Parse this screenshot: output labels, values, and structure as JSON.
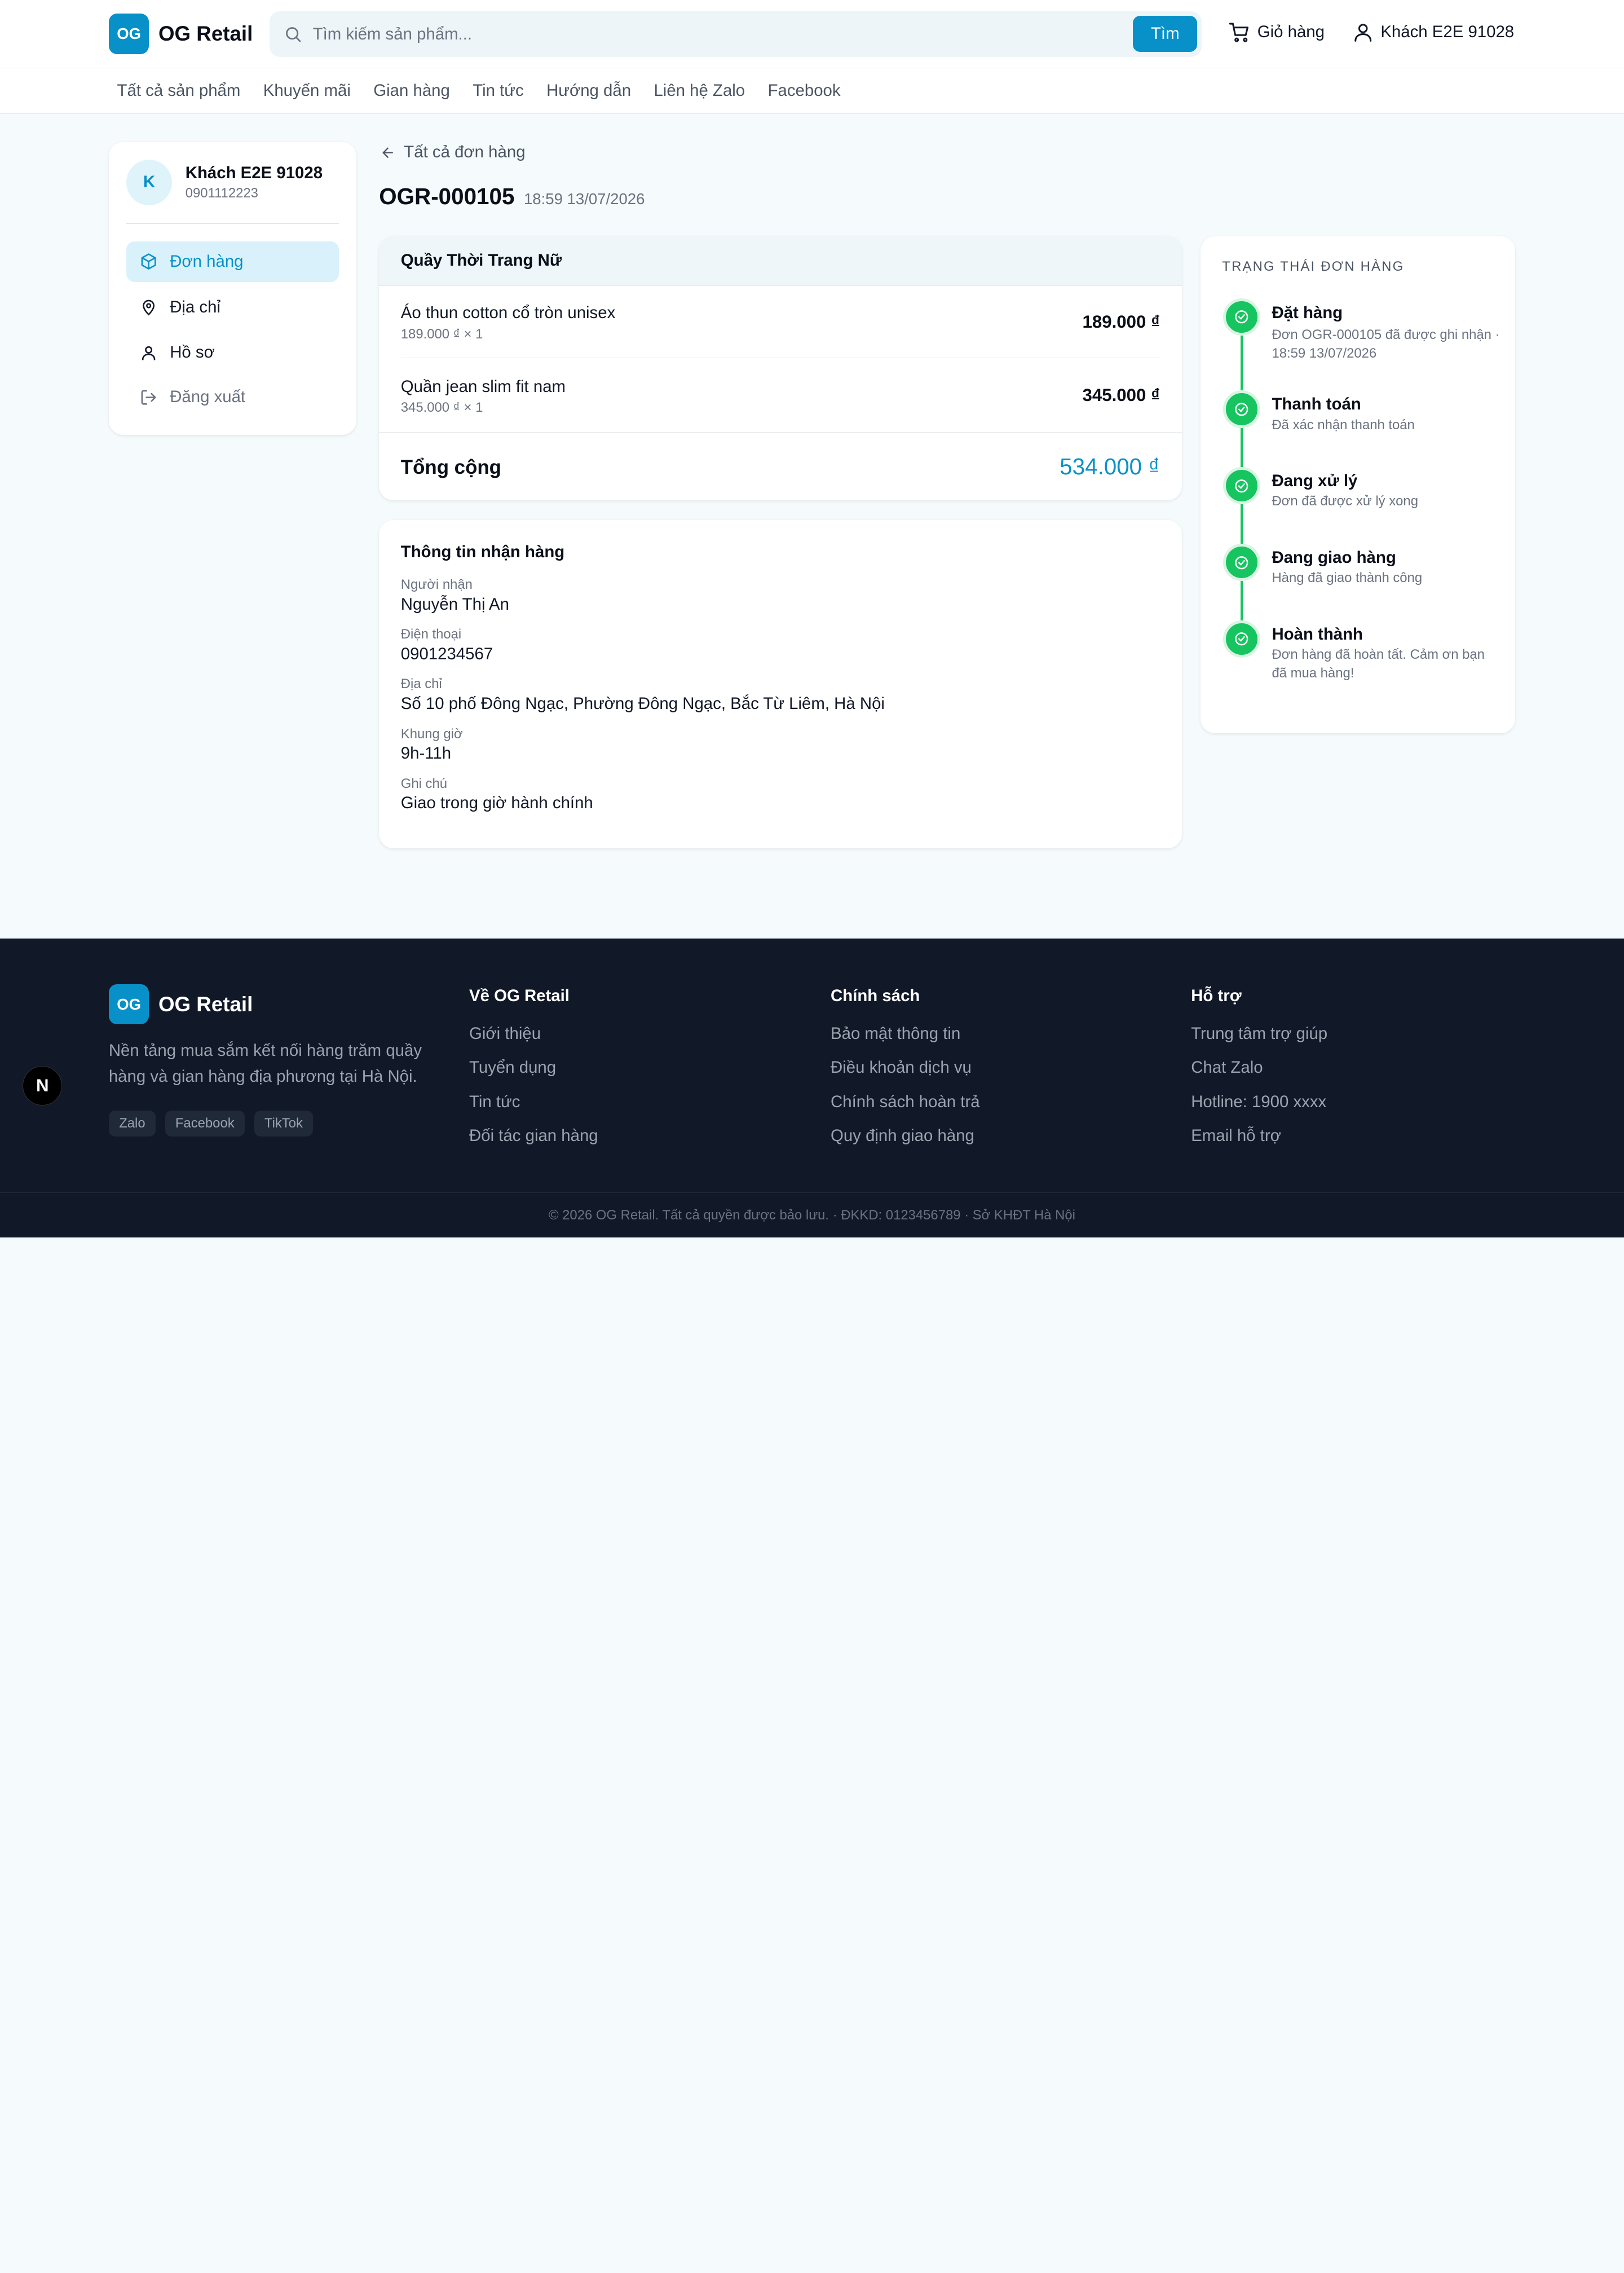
{
  "header": {
    "logo_badge": "OG",
    "logo_text": "OG Retail",
    "search_placeholder": "Tìm kiếm sản phẩm...",
    "search_button": "Tìm",
    "cart_label": "Giỏ hàng",
    "user_label": "Khách E2E 91028"
  },
  "nav": {
    "items": [
      "Tất cả sản phẩm",
      "Khuyến mãi",
      "Gian hàng",
      "Tin tức",
      "Hướng dẫn",
      "Liên hệ Zalo",
      "Facebook"
    ]
  },
  "sidebar": {
    "avatar_letter": "K",
    "name": "Khách E2E 91028",
    "phone": "0901112223",
    "items": [
      {
        "label": "Đơn hàng",
        "icon": "package-icon"
      },
      {
        "label": "Địa chỉ",
        "icon": "map-pin-icon"
      },
      {
        "label": "Hồ sơ",
        "icon": "user-icon"
      },
      {
        "label": "Đăng xuất",
        "icon": "logout-icon"
      }
    ]
  },
  "order": {
    "back_label": "Tất cả đơn hàng",
    "code": "OGR-000105",
    "time": "18:59 13/07/2026",
    "shop_name": "Quầy Thời Trang Nữ",
    "items": [
      {
        "name": "Áo thun cotton cổ tròn unisex",
        "meta": "189.000 ₫ × 1",
        "price": "189.000 ₫"
      },
      {
        "name": "Quần jean slim fit nam",
        "meta": "345.000 ₫ × 1",
        "price": "345.000 ₫"
      }
    ],
    "total_label": "Tổng cộng",
    "total_value": "534.000 ₫"
  },
  "shipping": {
    "title": "Thông tin nhận hàng",
    "fields": [
      {
        "label": "Người nhận",
        "value": "Nguyễn Thị An"
      },
      {
        "label": "Điện thoại",
        "value": "0901234567"
      },
      {
        "label": "Địa chỉ",
        "value": "Số 10 phố Đông Ngạc, Phường Đông Ngạc, Bắc Từ Liêm, Hà Nội"
      },
      {
        "label": "Khung giờ",
        "value": "9h-11h"
      },
      {
        "label": "Ghi chú",
        "value": "Giao trong giờ hành chính"
      }
    ]
  },
  "status": {
    "heading": "TRẠNG THÁI ĐƠN HÀNG",
    "accent_color": "#16c55f",
    "steps": [
      {
        "title": "Đặt hàng",
        "desc": "Đơn OGR-000105 đã được ghi nhận · 18:59 13/07/2026"
      },
      {
        "title": "Thanh toán",
        "desc": "Đã xác nhận thanh toán"
      },
      {
        "title": "Đang xử lý",
        "desc": "Đơn đã được xử lý xong"
      },
      {
        "title": "Đang giao hàng",
        "desc": "Hàng đã giao thành công"
      },
      {
        "title": "Hoàn thành",
        "desc": "Đơn hàng đã hoàn tất. Cảm ơn bạn đã mua hàng!"
      }
    ]
  },
  "footer": {
    "logo_badge": "OG",
    "logo_text": "OG Retail",
    "description": "Nền tảng mua sắm kết nối hàng trăm quầy hàng và gian hàng địa phương tại Hà Nội.",
    "tags": [
      "Zalo",
      "Facebook",
      "TikTok"
    ],
    "columns": [
      {
        "title": "Về OG Retail",
        "links": [
          "Giới thiệu",
          "Tuyển dụng",
          "Tin tức",
          "Đối tác gian hàng"
        ]
      },
      {
        "title": "Chính sách",
        "links": [
          "Bảo mật thông tin",
          "Điều khoản dịch vụ",
          "Chính sách hoàn trả",
          "Quy định giao hàng"
        ]
      },
      {
        "title": "Hỗ trợ",
        "links": [
          "Trung tâm trợ giúp",
          "Chat Zalo",
          "Hotline: 1900 xxxx",
          "Email hỗ trợ"
        ]
      }
    ],
    "copyright": "© 2026 OG Retail. Tất cả quyền được bảo lưu. · ĐKKD: 0123456789 · Sở KHĐT Hà Nội"
  },
  "floating_badge": "N",
  "colors": {
    "brand": "#0891c9",
    "footer_bg": "#111827"
  }
}
